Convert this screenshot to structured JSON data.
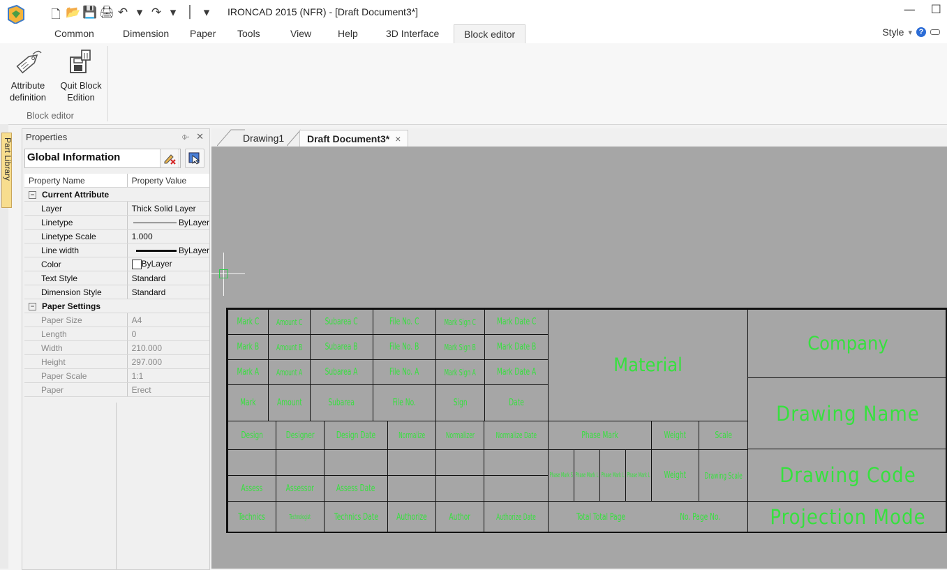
{
  "window": {
    "title": "IRONCAD 2015 (NFR) - [Draft Document3*]",
    "minimize": "—",
    "maximize": "☐"
  },
  "qat": [
    "🗋",
    "📂",
    "💾",
    "🖨",
    "↶",
    "▾",
    "↷",
    "▾",
    "│",
    "▾"
  ],
  "ribbon": {
    "tabs": [
      "Common",
      "Dimension",
      "Paper",
      "Tools",
      "View",
      "Help",
      "3D Interface",
      "Block editor"
    ],
    "active_tab": "Block editor",
    "style_label": "Style",
    "style_arrow": "▾",
    "help": "?",
    "buttons": [
      {
        "line1": "Attribute",
        "line2": "definition"
      },
      {
        "line1": "Quit Block",
        "line2": "Edition"
      }
    ],
    "group_label": "Block editor"
  },
  "part_library_label": "Part Library",
  "properties": {
    "title": "Properties",
    "pin": "⌱",
    "close": "✕",
    "combo_value": "Global Information",
    "combo_arrow": "∨",
    "headers": [
      "Property Name",
      "Property Value"
    ],
    "sections": [
      {
        "name": "Current Attribute",
        "rows": [
          {
            "name": "Layer",
            "value": "Thick Solid Layer"
          },
          {
            "name": "Linetype",
            "value": "ByLayer"
          },
          {
            "name": "Linetype Scale",
            "value": "1.000"
          },
          {
            "name": "Line width",
            "value": "ByLayer"
          },
          {
            "name": "Color",
            "value": "ByLayer"
          },
          {
            "name": "Text Style",
            "value": "Standard"
          },
          {
            "name": "Dimension Style",
            "value": "Standard"
          }
        ]
      },
      {
        "name": "Paper Settings",
        "rows": [
          {
            "name": "Paper Size",
            "value": "A4"
          },
          {
            "name": "Length",
            "value": "0"
          },
          {
            "name": "Width",
            "value": "210.000"
          },
          {
            "name": "Height",
            "value": "297.000"
          },
          {
            "name": "Paper Scale",
            "value": "1:1"
          },
          {
            "name": "Paper",
            "value": "Erect"
          }
        ]
      }
    ]
  },
  "doc_tabs": [
    "Drawing1",
    "Draft Document3*"
  ],
  "doc_tab_close": "×",
  "title_block": {
    "rows": [
      [
        "Mark C",
        "Amount C",
        "Subarea C",
        "File No. C",
        "Mark Sign C",
        "Mark Date C"
      ],
      [
        "Mark B",
        "Amount B",
        "Subarea B",
        "File No. B",
        "Mark Sign B",
        "Mark Date B"
      ],
      [
        "Mark A",
        "Amount A",
        "Subarea A",
        "File No. A",
        "Mark Sign A",
        "Mark Date A"
      ],
      [
        "Mark",
        "Amount",
        "Subarea",
        "File No.",
        "Sign",
        "Date"
      ],
      [
        "Design",
        "Designer",
        "Design Date",
        "Normalize",
        "Normalizer",
        "Normalize Date"
      ],
      [
        "",
        "",
        "",
        "",
        "",
        ""
      ],
      [
        "Assess",
        "Assessor",
        "Assess Date",
        "",
        "",
        ""
      ],
      [
        "Technics",
        "Technologist",
        "Technics Date",
        "Authorize",
        "Author",
        "Authorize Date"
      ]
    ],
    "material": "Material",
    "phase_mark": "Phase Mark",
    "weight_header": "Weight",
    "scale_header": "Scale",
    "phase_cells": [
      "Phase Mark S",
      "Phase Mark L",
      "Phase Mark L",
      "Phase Mark L"
    ],
    "weight_value": "Weight",
    "drawing_scale": "Drawing Scale",
    "total_page": "Total Total Page",
    "page_no": "No. Page No.",
    "company": "Company",
    "drawing_name": "Drawing Name",
    "drawing_code": "Drawing Code",
    "projection_mode": "Projection Mode"
  },
  "colors": {
    "canvas_bg": "#a6a6a6",
    "title_block_text": "#37e03f"
  }
}
